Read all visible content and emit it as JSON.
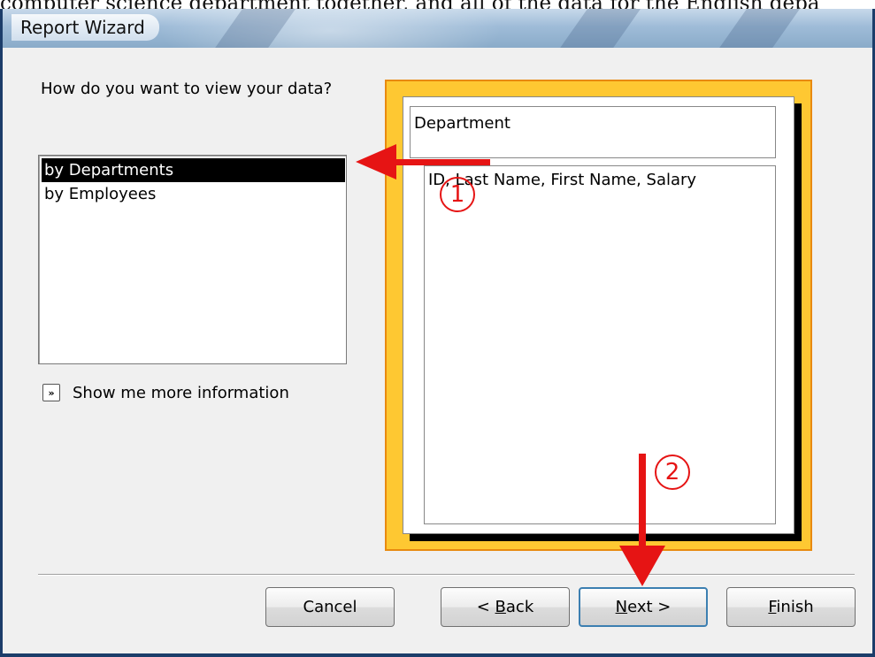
{
  "page": {
    "top_caption": "computer science department together, and all of the data for the English depa"
  },
  "window": {
    "title": "Report Wizard"
  },
  "left_panel": {
    "question": "How do you want to view your data?",
    "view_options": [
      {
        "label": "by Departments",
        "selected": true
      },
      {
        "label": "by Employees",
        "selected": false
      }
    ],
    "more_info_icon": "double-chevron-right-icon",
    "more_info_label": "Show me more information"
  },
  "preview": {
    "group_header": "Department",
    "detail_fields": "ID, Last Name, First Name, Salary"
  },
  "buttons": {
    "cancel": "Cancel",
    "back_prefix": "< ",
    "back_access": "B",
    "back_rest": "ack",
    "next_access": "N",
    "next_rest": "ext >",
    "finish_access": "F",
    "finish_rest": "inish"
  },
  "annotations": {
    "step1": "1",
    "step2": "2",
    "color": "#e61414"
  },
  "colors": {
    "preview_background": "#fec832",
    "preview_border": "#e88a10",
    "selection": "#000000",
    "default_button_border": "#3c7fb1"
  }
}
